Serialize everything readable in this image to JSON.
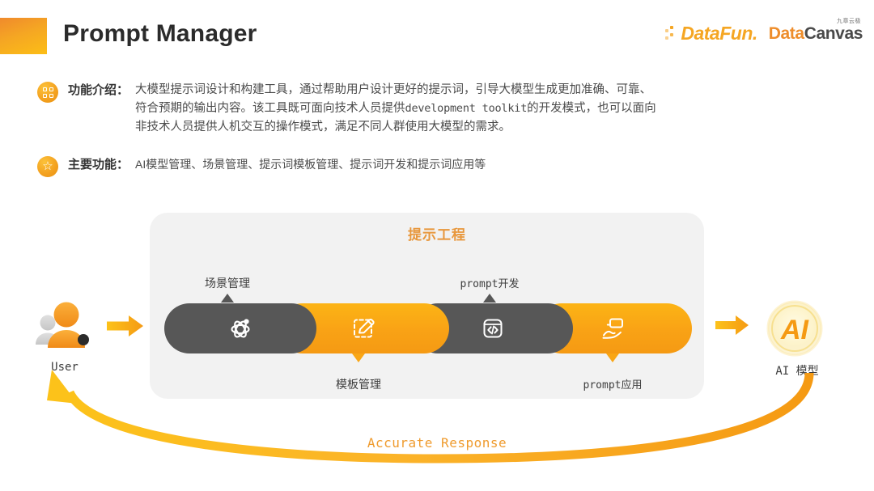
{
  "header": {
    "title": "Prompt Manager",
    "logos": {
      "datafun": "DataFun.",
      "datacanvas_primary": "Data",
      "datacanvas_secondary": "Canvas",
      "datacanvas_cn": "九章云极"
    },
    "accent_color": "#f5a623"
  },
  "intro": {
    "icon": "grid-icon",
    "label": "功能介绍：",
    "line1": "大模型提示词设计和构建工具，通过帮助用户设计更好的提示词，引导大模型生成更加准确、可靠、",
    "line2_a": "符合预期的输出内容。该工具既可面向技术人员提供",
    "line2_mono": "development toolkit",
    "line2_b": "的开发模式，也可以面向",
    "line3": "非技术人员提供人机交互的操作模式，满足不同人群使用大模型的需求。"
  },
  "features": {
    "icon": "star-icon",
    "label": "主要功能：",
    "value": "AI模型管理、场景管理、提示词模板管理、提示词开发和提示词应用等"
  },
  "diagram": {
    "panel_title": "提示工程",
    "panel_title_color": "#e8973c",
    "segments": [
      {
        "id": "scene-management",
        "icon": "atom-icon",
        "style": "dark",
        "label": "场景管理",
        "label_position": "top"
      },
      {
        "id": "template-management",
        "icon": "pencil-edit-icon",
        "style": "orange",
        "label": "模板管理",
        "label_position": "bottom"
      },
      {
        "id": "prompt-development",
        "icon": "code-window-icon",
        "style": "dark",
        "label": "prompt开发",
        "label_position": "top"
      },
      {
        "id": "prompt-application",
        "icon": "hand-card-icon",
        "style": "orange",
        "label": "prompt应用",
        "label_position": "bottom"
      }
    ],
    "left_node": {
      "icon": "user-avatar-icon",
      "label": "User"
    },
    "right_node": {
      "icon": "ai-orb-icon",
      "label": "AI 模型"
    },
    "feedback_label": "Accurate Response",
    "colors": {
      "dark": "#575757",
      "orange": "#f9a215",
      "panel": "#f2f2f2"
    }
  }
}
